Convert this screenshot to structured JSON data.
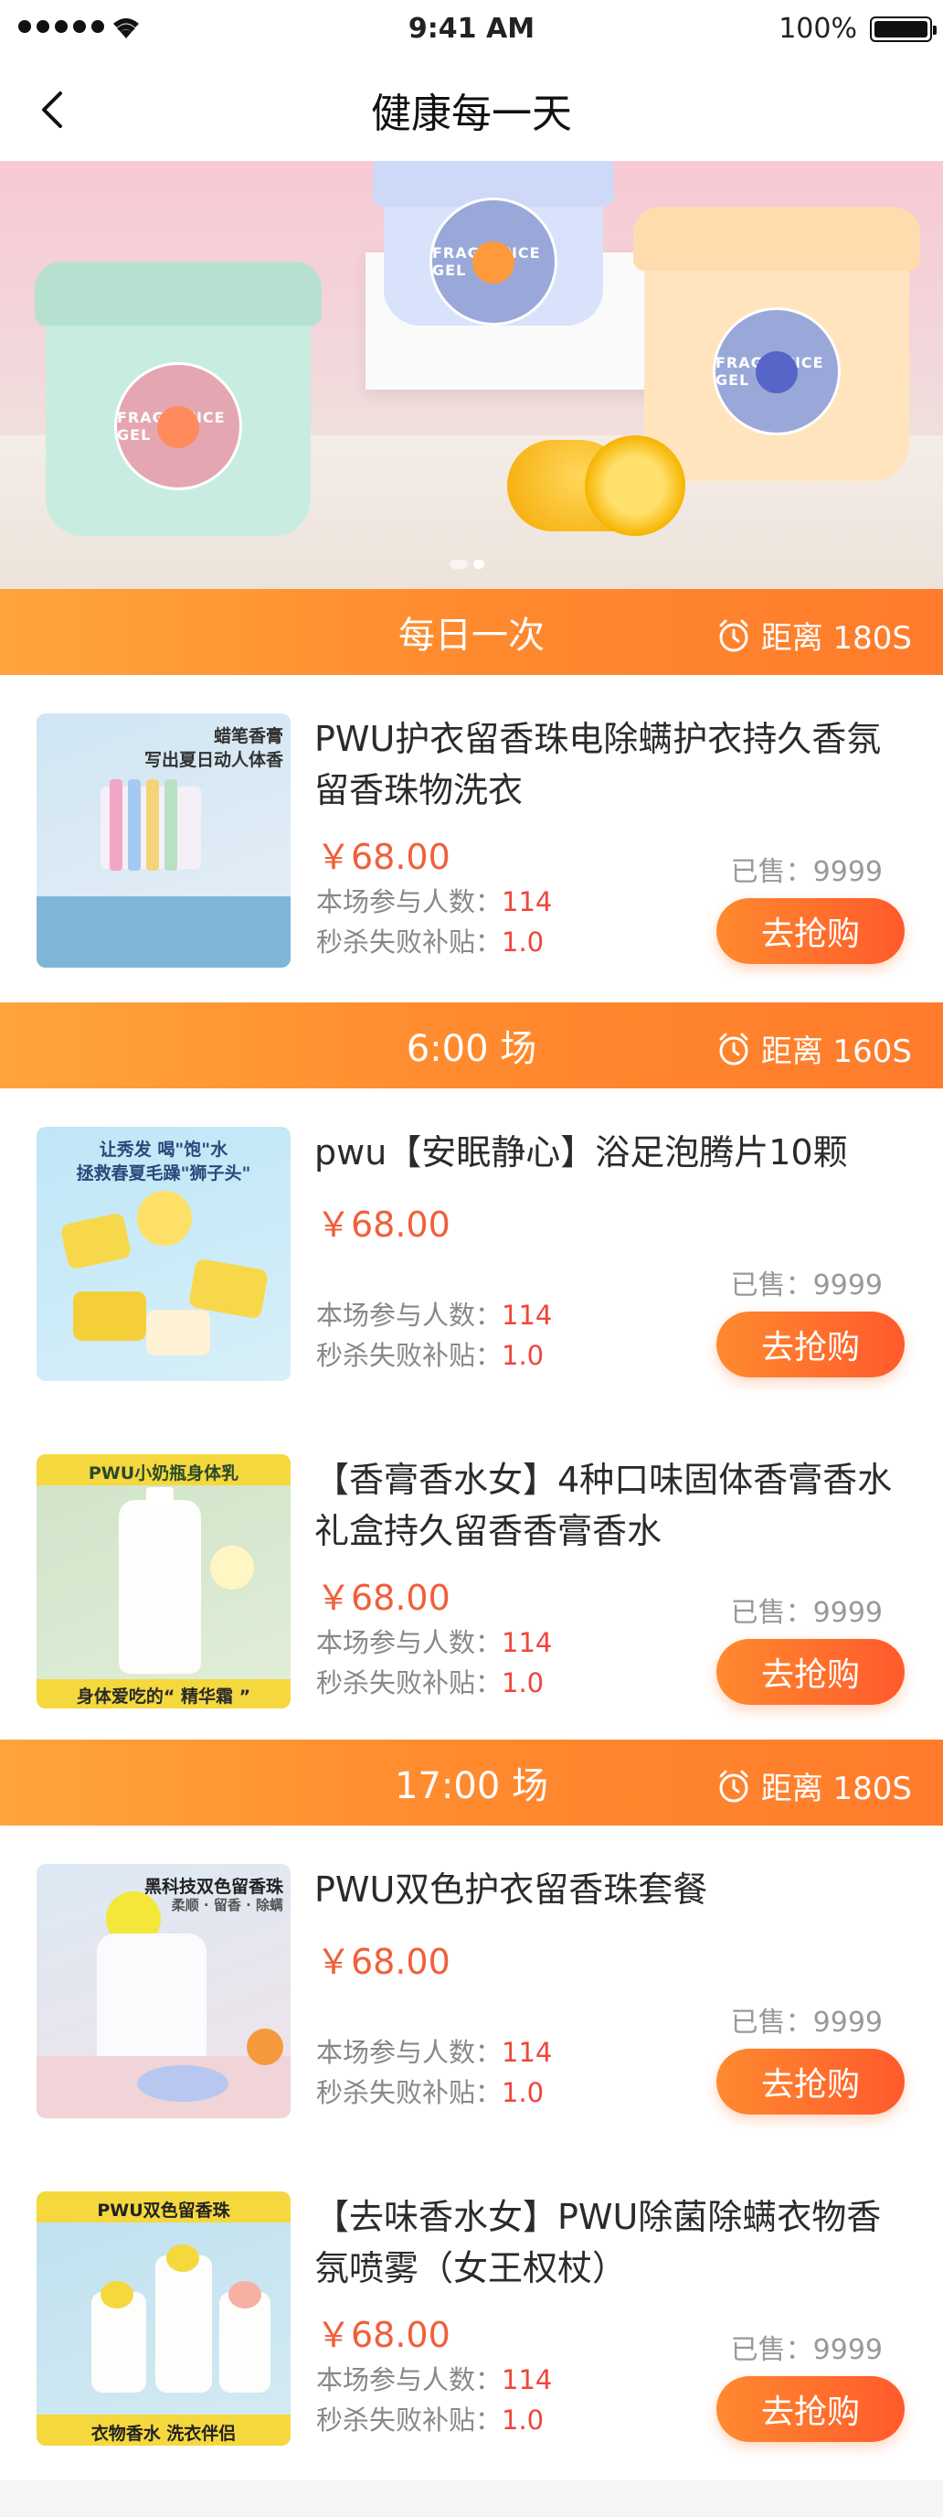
{
  "status_bar": {
    "time": "9:41 AM",
    "battery": "100%"
  },
  "nav": {
    "title": "健康每一天"
  },
  "banner": {
    "jars": [
      {
        "label": "FRAGRANCE GEL",
        "lid_color": "#bfe5d7",
        "body_color": "#c9ece0",
        "fruit_color": "#ff8a5b"
      },
      {
        "label": "FRAGRANCE GEL",
        "lid_color": "#cdd9f6",
        "body_color": "#d8e2fb",
        "fruit_color": "#ff9a3c"
      },
      {
        "label": "FRAGRANCE GEL",
        "lid_color": "#ffdcae",
        "body_color": "#ffe4bd",
        "fruit_color": "#5865c8"
      }
    ]
  },
  "sections": [
    {
      "title": "每日一次",
      "countdown": "距离 180S"
    },
    {
      "title": "6:00 场",
      "countdown": "距离 160S"
    },
    {
      "title": "17:00 场",
      "countdown": "距离 180S"
    }
  ],
  "labels": {
    "participants": "本场参与人数：",
    "subsidy": "秒杀失败补贴：",
    "sold_prefix": "已售：",
    "buy": "去抢购"
  },
  "products": [
    {
      "name": "PWU护衣留香珠电除螨护衣持久香氛留香珠物洗衣",
      "price": "￥68.00",
      "sold": "9999",
      "participants": "114",
      "subsidy": "1.0",
      "img_text": [
        "蜡笔香膏",
        "写出夏日动人体香"
      ],
      "img_bg": "#cfe6f4"
    },
    {
      "name": "pwu【安眠静心】浴足泡腾片10颗",
      "price": "￥68.00",
      "sold": "9999",
      "participants": "114",
      "subsidy": "1.0",
      "img_text": [
        "让秀发 喝\"饱\"水",
        "拯救春夏毛躁\"狮子头\""
      ],
      "img_bg": "#bfe6f7"
    },
    {
      "name": "【香膏香水女】4种口味固体香膏香水礼盒持久留香香膏香水",
      "price": "￥68.00",
      "sold": "9999",
      "participants": "114",
      "subsidy": "1.0",
      "img_text": [
        "PWU小奶瓶身体乳",
        "身体爱吃的“ 精华霜 ”"
      ],
      "img_bg": "#cfe3c8"
    },
    {
      "name": "PWU双色护衣留香珠套餐",
      "price": "￥68.00",
      "sold": "9999",
      "participants": "114",
      "subsidy": "1.0",
      "img_text": [
        "黑科技双色留香珠",
        "柔顺 · 留香 · 除螨"
      ],
      "img_bg": "#dce9f4"
    },
    {
      "name": "【去味香水女】PWU除菌除螨衣物香氛喷雾（女王权杖）",
      "price": "￥68.00",
      "sold": "9999",
      "participants": "114",
      "subsidy": "1.0",
      "img_text": [
        "PWU双色留香珠",
        "衣物香水 洗衣伴侣"
      ],
      "img_bg": "#bfe0ef"
    }
  ],
  "colors": {
    "accent_start": "#ffa43a",
    "accent_end": "#ff7b2c",
    "price": "#f05f3a",
    "highlight": "#f0453a"
  }
}
